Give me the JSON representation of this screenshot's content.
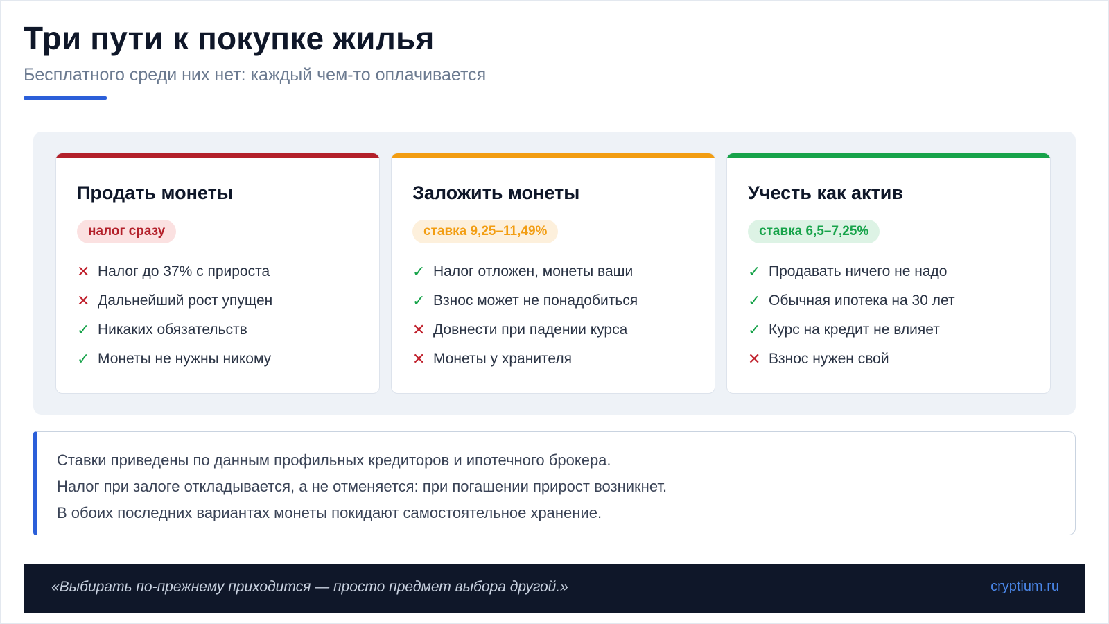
{
  "header": {
    "title": "Три пути к покупке жилья",
    "subtitle": "Бесплатного среди них нет: каждый чем-то оплачивается"
  },
  "cards": [
    {
      "title": "Продать монеты",
      "badge": "налог сразу",
      "accent_color": "#b3202a",
      "badge_bg": "#fbe1e1",
      "items": [
        {
          "mark": "✕",
          "type": "minus",
          "text": "Налог до 37% с прироста"
        },
        {
          "mark": "✕",
          "type": "minus",
          "text": "Дальнейший рост упущен"
        },
        {
          "mark": "✓",
          "type": "plus",
          "text": "Никаких обязательств"
        },
        {
          "mark": "✓",
          "type": "plus",
          "text": "Монеты не нужны никому"
        }
      ]
    },
    {
      "title": "Заложить монеты",
      "badge": "ставка 9,25–11,49%",
      "accent_color": "#f29d12",
      "badge_bg": "#fdf0dc",
      "items": [
        {
          "mark": "✓",
          "type": "plus",
          "text": "Налог отложен, монеты ваши"
        },
        {
          "mark": "✓",
          "type": "plus",
          "text": "Взнос может не понадобиться"
        },
        {
          "mark": "✕",
          "type": "minus",
          "text": "Довнести при падении курса"
        },
        {
          "mark": "✕",
          "type": "minus",
          "text": "Монеты у хранителя"
        }
      ]
    },
    {
      "title": "Учесть как актив",
      "badge": "ставка 6,5–7,25%",
      "accent_color": "#17a34a",
      "badge_bg": "#ddf3e5",
      "items": [
        {
          "mark": "✓",
          "type": "plus",
          "text": "Продавать ничего не надо"
        },
        {
          "mark": "✓",
          "type": "plus",
          "text": "Обычная ипотека на 30 лет"
        },
        {
          "mark": "✓",
          "type": "plus",
          "text": "Курс на кредит не влияет"
        },
        {
          "mark": "✕",
          "type": "minus",
          "text": "Взнос нужен свой"
        }
      ]
    }
  ],
  "note": {
    "lines": [
      "Ставки приведены по данным профильных кредиторов и ипотечного брокера.",
      "Налог при залоге откладывается, а не отменяется: при погашении прирост возникнет.",
      "В обоих последних вариантах монеты покидают самостоятельное хранение."
    ]
  },
  "footer": {
    "quote": "«Выбирать по-прежнему приходится — просто предмет выбора другой.»",
    "site": "cryptium.ru"
  },
  "colors": {
    "accent_blue": "#2b5fd9",
    "check_green": "#17a34a",
    "cross_red": "#c0202c"
  }
}
